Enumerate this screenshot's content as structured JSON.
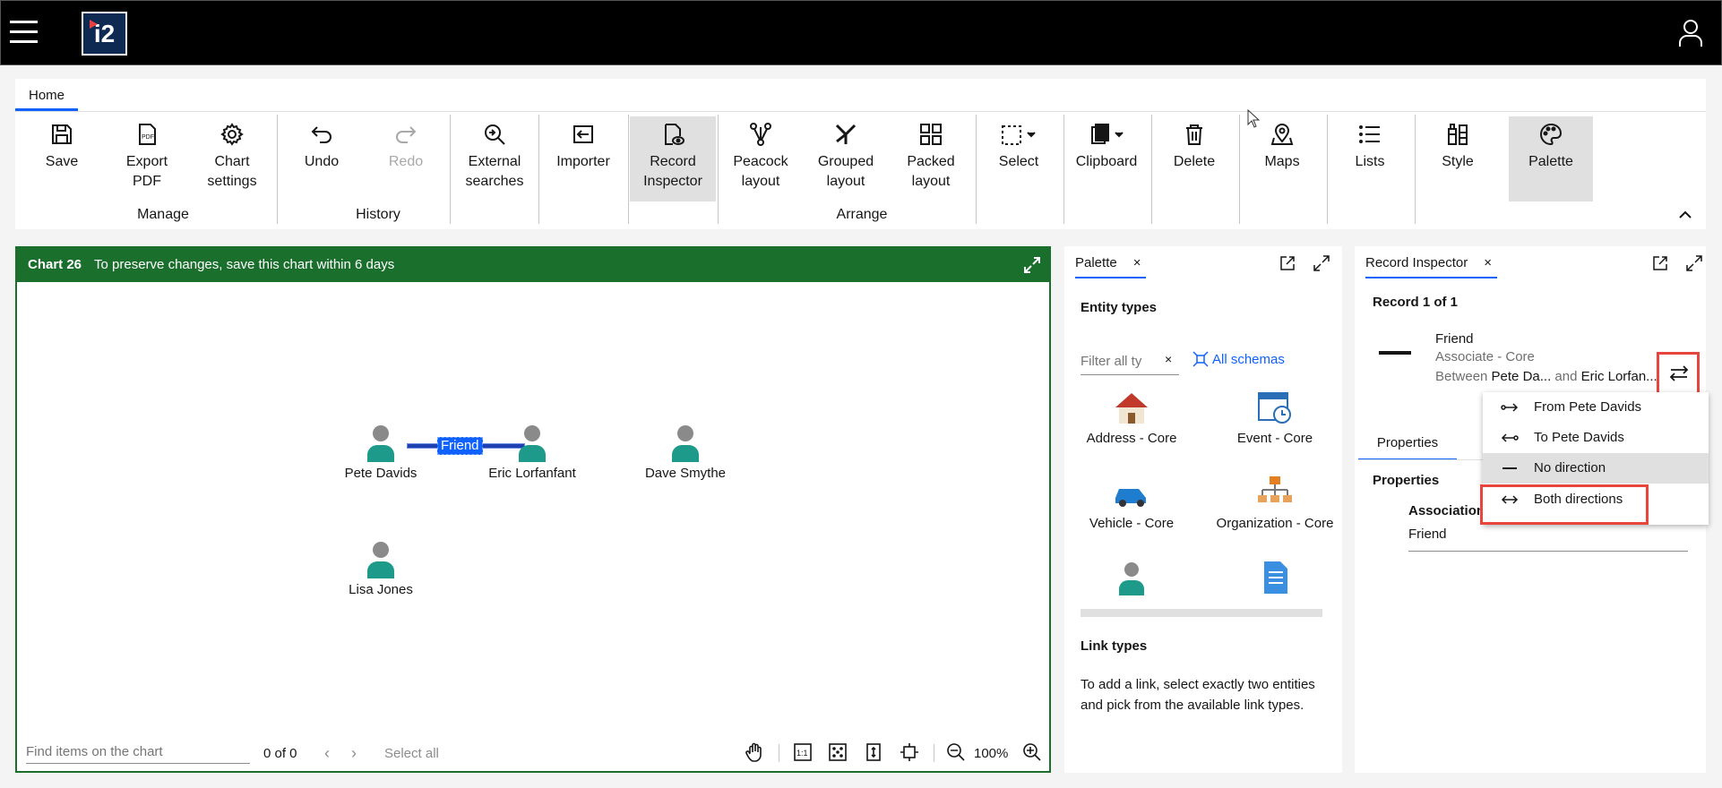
{
  "app": {
    "logo_text": "i2"
  },
  "ribbon": {
    "tab_home": "Home",
    "buttons": {
      "save": "Save",
      "export_pdf_1": "Export",
      "export_pdf_2": "PDF",
      "chart_settings_1": "Chart",
      "chart_settings_2": "settings",
      "undo": "Undo",
      "redo": "Redo",
      "external_searches_1": "External",
      "external_searches_2": "searches",
      "importer": "Importer",
      "record_inspector_1": "Record",
      "record_inspector_2": "Inspector",
      "peacock_1": "Peacock",
      "peacock_2": "layout",
      "grouped_1": "Grouped",
      "grouped_2": "layout",
      "packed_1": "Packed",
      "packed_2": "layout",
      "select": "Select",
      "clipboard": "Clipboard",
      "delete": "Delete",
      "maps": "Maps",
      "lists": "Lists",
      "style": "Style",
      "palette": "Palette"
    },
    "groups": {
      "manage": "Manage",
      "history": "History",
      "arrange": "Arrange"
    }
  },
  "chart": {
    "name": "Chart 26",
    "notice": "To preserve changes, save this chart within 6 days",
    "nodes": [
      "Pete Davids",
      "Eric Lorfanfant",
      "Dave Smythe",
      "Lisa Jones"
    ],
    "link_label": "Friend",
    "footer": {
      "find_placeholder": "Find items on the chart",
      "count": "0 of 0",
      "select_all": "Select all",
      "zoom": "100%"
    }
  },
  "palette": {
    "tab": "Palette",
    "close": "×",
    "entity_types_title": "Entity types",
    "filter_placeholder": "Filter all ty",
    "filter_clear": "×",
    "all_schemas": "All schemas",
    "entities": [
      "Address - Core",
      "Event - Core",
      "Vehicle - Core",
      "Organization - Core"
    ],
    "link_types_title": "Link types",
    "link_help": "To add a link, select exactly two entities and pick from the available link types."
  },
  "inspector": {
    "tab": "Record Inspector",
    "close": "×",
    "record_count": "Record 1 of 1",
    "record_title": "Friend",
    "record_type": "Associate - Core",
    "between_label": "Between",
    "between_entity_1": "Pete Da...",
    "and_label": "and",
    "between_entity_2": "Eric Lorfan...",
    "properties_tab": "Properties",
    "properties_heading": "Properties",
    "association_label": "Association",
    "association_value": "Friend"
  },
  "direction_menu": {
    "items": [
      "From Pete Davids",
      "To Pete Davids",
      "No direction",
      "Both directions"
    ],
    "hovered": "No direction",
    "highlighted": "Both directions"
  },
  "colors": {
    "chart_header": "#1a6f2d",
    "accent": "#0f62fe",
    "highlight_box": "#e8453c",
    "top_bar": "#000000"
  }
}
